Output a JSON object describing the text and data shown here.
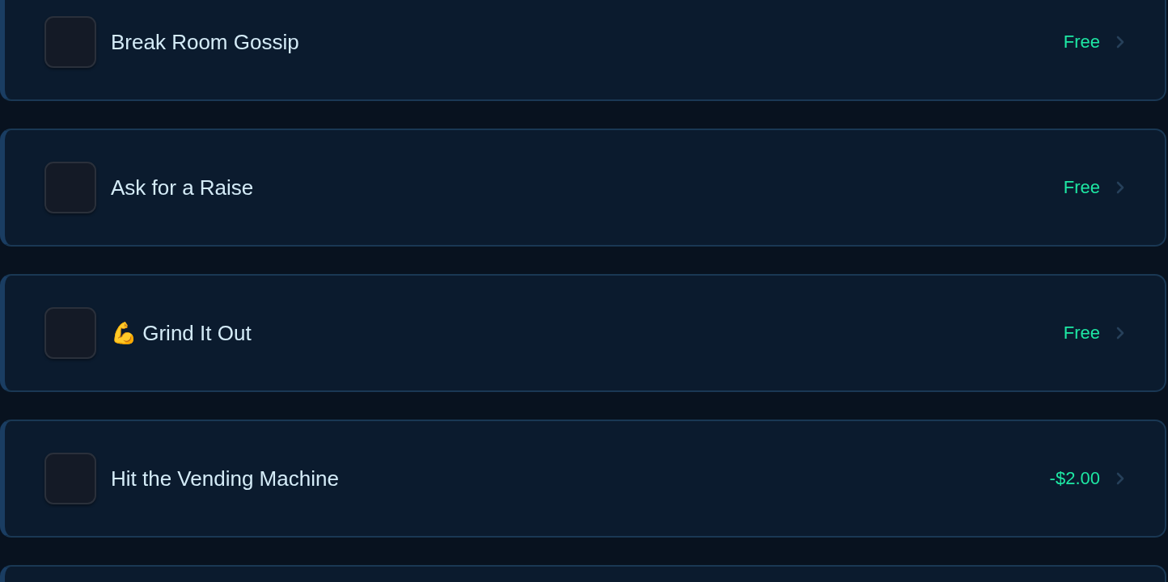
{
  "items": [
    {
      "title": "Break Room Gossip",
      "price": "Free"
    },
    {
      "title": "Ask for a Raise",
      "price": "Free"
    },
    {
      "title": "💪 Grind It Out",
      "price": "Free"
    },
    {
      "title": "Hit the Vending Machine",
      "price": "-$2.00"
    }
  ]
}
